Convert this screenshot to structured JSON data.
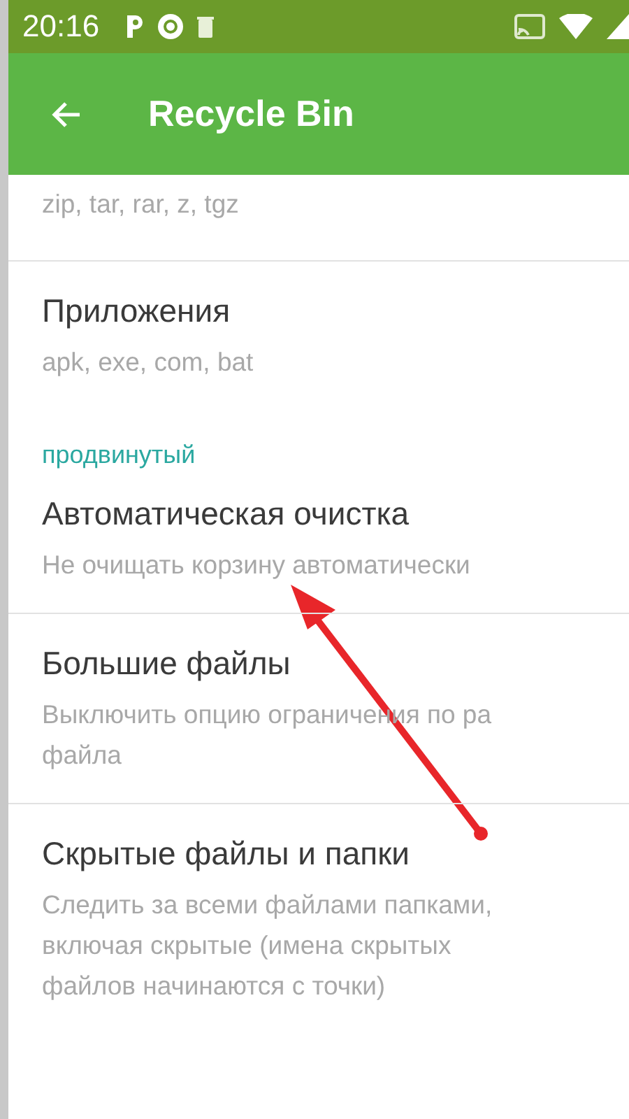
{
  "status_bar": {
    "time": "20:16"
  },
  "app_bar": {
    "title": "Recycle Bin"
  },
  "items": [
    {
      "kind": "row",
      "lines": [
        "zip, tar, rar, z, tgz"
      ]
    },
    {
      "kind": "row",
      "title": "Приложения",
      "lines": [
        "apk, exe, com, bat"
      ]
    },
    {
      "kind": "header",
      "title": "продвинутый"
    },
    {
      "kind": "row",
      "title": "Автоматическая очистка",
      "lines": [
        "Не очищать корзину автоматически"
      ]
    },
    {
      "kind": "row",
      "title": "Большие файлы",
      "lines": [
        "Выключить опцию ограничения по ра",
        "файла"
      ]
    },
    {
      "kind": "row",
      "title": "Скрытые файлы и папки",
      "lines": [
        "Следить за всеми файлами папками,",
        "включая скрытые (имена скрытых",
        "файлов начинаются с точки)"
      ]
    }
  ]
}
